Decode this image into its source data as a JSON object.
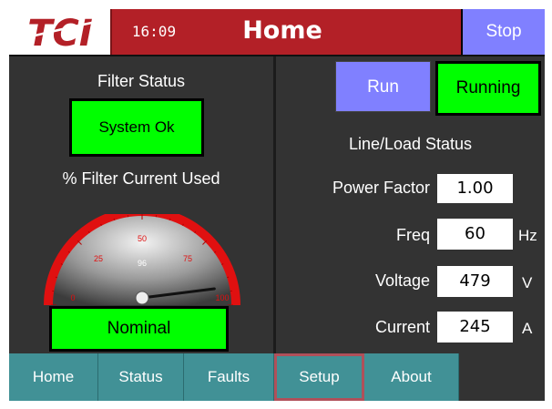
{
  "header": {
    "time": "16:09",
    "title": "Home",
    "stop_label": "Stop",
    "logo_text": "TCI"
  },
  "left": {
    "filter_status_label": "Filter Status",
    "filter_status_value": "System Ok",
    "filter_current_label": "% Filter Current Used",
    "gauge": {
      "value": 96,
      "min": 0,
      "max": 100,
      "ticks": [
        "0",
        "25",
        "50",
        "75",
        "100"
      ]
    },
    "state_value": "Nominal"
  },
  "right": {
    "run_label": "Run",
    "running_label": "Running",
    "section_title": "Line/Load Status",
    "power_factor": {
      "label": "Power Factor",
      "value": "1.00",
      "unit": ""
    },
    "freq": {
      "label": "Freq",
      "value": "60",
      "unit": "Hz"
    },
    "voltage": {
      "label": "Voltage",
      "value": "479",
      "unit": "V"
    },
    "current": {
      "label": "Current",
      "value": "245",
      "unit": "A"
    }
  },
  "nav": {
    "tabs": [
      "Home",
      "Status",
      "Faults",
      "Setup",
      "About"
    ],
    "selected": "Setup"
  },
  "colors": {
    "header": "#b32027",
    "accent_blue": "#8080ff",
    "status_green": "#00ff00",
    "tab": "#419196",
    "tab_selected_border": "#b0505a",
    "background": "#333333"
  }
}
